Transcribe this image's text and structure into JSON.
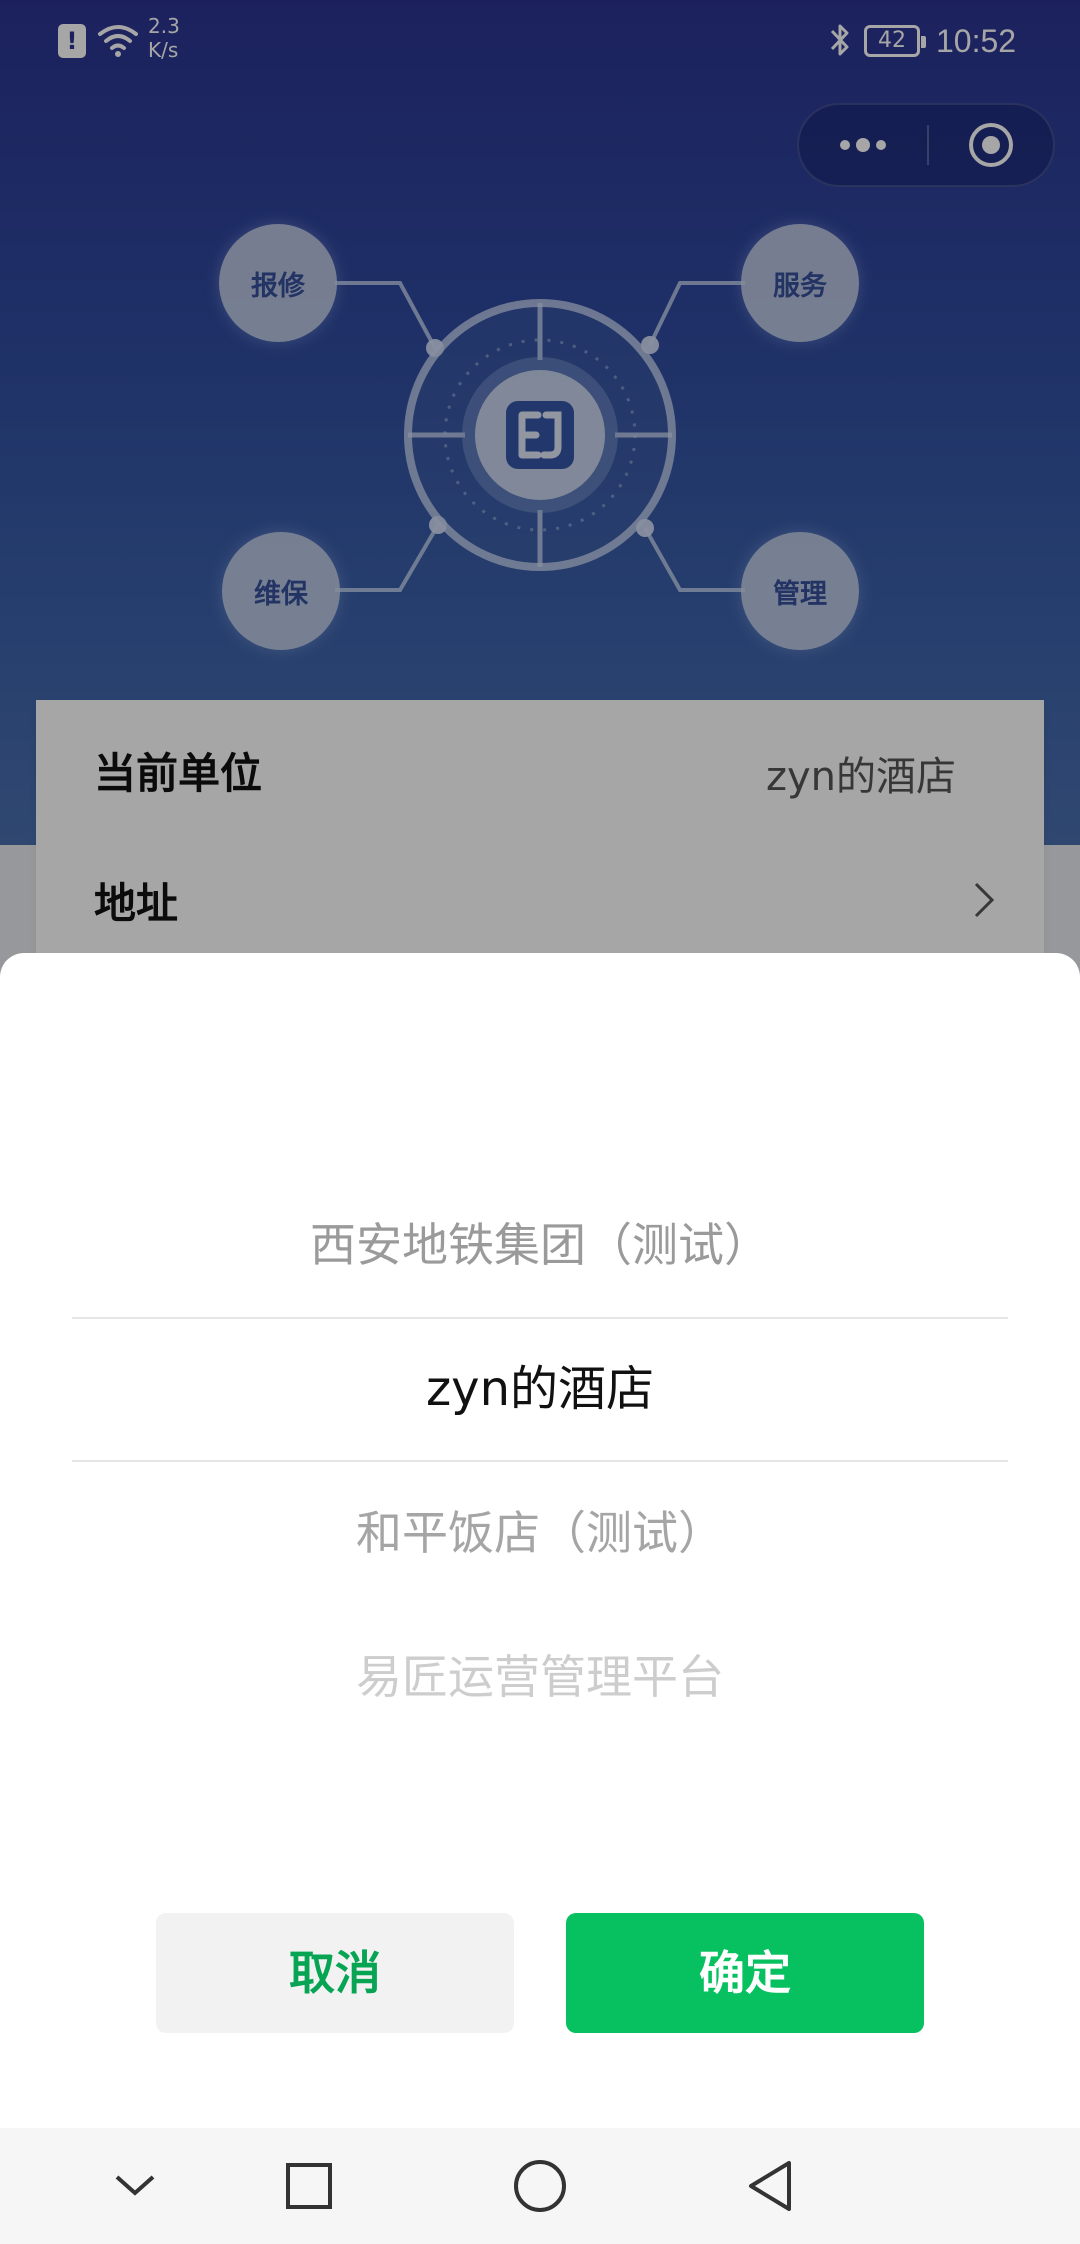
{
  "status_bar": {
    "net_speed_value": "2.3",
    "net_speed_unit": "K/s",
    "battery": "42",
    "time": "10:52",
    "icons": [
      "alert-icon",
      "wifi-icon",
      "bluetooth-icon",
      "battery-icon"
    ]
  },
  "capsule": {
    "more_icon": "more-dots-icon",
    "close_icon": "close-miniprogram-icon"
  },
  "hero": {
    "logo_icon": "ej-logo-icon",
    "nodes": [
      "报修",
      "服务",
      "维保",
      "管理"
    ]
  },
  "info_card": {
    "unit_label": "当前单位",
    "unit_value": "zyn的酒店",
    "address_label": "地址"
  },
  "picker": {
    "options": [
      "西安地铁集团（测试）",
      "zyn的酒店",
      "和平饭店（测试）",
      "易匠运营管理平台"
    ],
    "selected": "zyn的酒店",
    "cancel_label": "取消",
    "confirm_label": "确定"
  },
  "colors": {
    "header_top": "#2c3490",
    "confirm_green": "#07c160",
    "cancel_text_green": "#07a454"
  },
  "nav_bar": {
    "icons": [
      "nav-down-icon",
      "nav-recent-icon",
      "nav-home-icon",
      "nav-back-icon"
    ]
  }
}
